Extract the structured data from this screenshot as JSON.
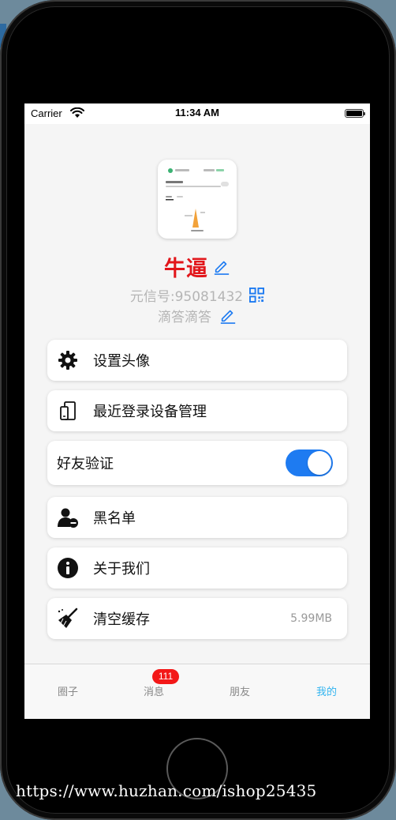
{
  "status_bar": {
    "carrier": "Carrier",
    "time": "11:34 AM"
  },
  "profile": {
    "nickname": "牛逼",
    "id_text": "元信号:95081432",
    "signature": "滴答滴答"
  },
  "menu": {
    "set_avatar": "设置头像",
    "devices": "最近登录设备管理",
    "friend_verify": "好友验证",
    "friend_verify_enabled": true,
    "blacklist": "黑名单",
    "about": "关于我们",
    "clear_cache": "清空缓存",
    "cache_size": "5.99MB"
  },
  "tabbar": {
    "tabs": [
      {
        "label": "圈子"
      },
      {
        "label": "消息"
      },
      {
        "label": "朋友"
      },
      {
        "label": "我的"
      }
    ],
    "message_badge": "111",
    "active_index": 3
  },
  "colors": {
    "nickname": "#e2161b",
    "accent": "#1e7bf1",
    "tab_active": "#32b4f0",
    "badge": "#f31818"
  },
  "watermark": "https://www.huzhan.com/ishop25435"
}
